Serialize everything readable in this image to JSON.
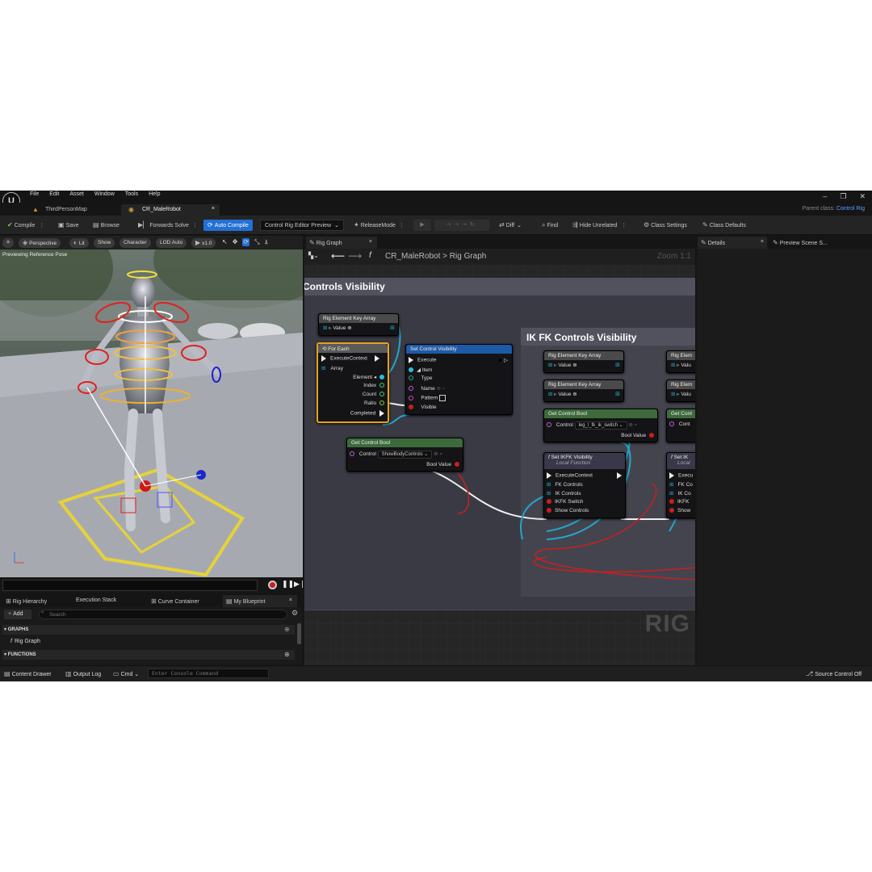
{
  "menu": [
    "File",
    "Edit",
    "Asset",
    "Window",
    "Tools",
    "Help"
  ],
  "window": {
    "parent_label": "Parent class:",
    "parent_value": "Control Rig",
    "min": "–",
    "restore": "❐",
    "close": "✕"
  },
  "tabs": [
    {
      "label": "ThirdPersonMap"
    },
    {
      "label": "CR_MaleRobot",
      "close": "×"
    }
  ],
  "toolbar": {
    "compile": "Compile",
    "save": "Save",
    "browse": "Browse",
    "forwards": "Forwards Solve",
    "auto_compile": "Auto Compile",
    "preview": "Control Rig Editor Preview",
    "release": "ReleaseMode",
    "diff": "Diff",
    "find": "Find",
    "hide": "Hide Unrelated",
    "class_settings": "Class Settings",
    "class_defaults": "Class Defaults"
  },
  "viewport": {
    "perspective": "Perspective",
    "lit": "Lit",
    "show": "Show",
    "character": "Character",
    "lod": "LOD Auto",
    "speed": "x1.0",
    "previewing": "Previewing Reference Pose"
  },
  "left_tabs": [
    "Rig Hierarchy",
    "Execution Stack",
    "Curve Container",
    "My Blueprint"
  ],
  "my_blueprint": {
    "add": "Add",
    "search_placeholder": "Search",
    "graphs": "GRAPHS",
    "rig_graph": "Rig Graph",
    "functions": "FUNCTIONS"
  },
  "graph_tab": {
    "label": "Rig Graph",
    "close": "×"
  },
  "breadcrumb": {
    "asset": "CR_MaleRobot",
    "sep": ">",
    "graph": "Rig Graph",
    "zoom": "Zoom 1:1"
  },
  "comments": {
    "left": "Controls Visibility",
    "right": "IK FK Controls Visibility"
  },
  "nodes": {
    "rig_key_array": {
      "title": "Rig Element Key Array",
      "pin": "Value"
    },
    "for_each": {
      "title": "For Each",
      "pins_in": [
        "ExecuteContext",
        "Array"
      ],
      "pins_out": [
        "Element",
        "Index",
        "Count",
        "Ratio",
        "Completed"
      ]
    },
    "set_vis": {
      "title": "Set Control Visibility",
      "pins": [
        "Execute",
        "Item",
        "Type",
        "Name",
        "Pattern",
        "Visible"
      ]
    },
    "get_bool_1": {
      "title": "Get Control Bool",
      "control_label": "Control",
      "control_value": "ShowBodyControls",
      "out": "Bool Value"
    },
    "rig_key_array_2": {
      "title": "Rig Element Key Array",
      "pin": "Value"
    },
    "rig_key_array_3": {
      "title": "Rig Element Key Array",
      "pin": "Value"
    },
    "get_bool_2": {
      "title": "Get Control Bool",
      "control_label": "Control",
      "control_value": "leg_l_fk_ik_switch",
      "out": "Bool Value"
    },
    "set_ikfk": {
      "title": "Set IKFK Visibility",
      "subtitle": "Local Function",
      "pins": [
        "ExecuteContext",
        "FK Controls",
        "IK Controls",
        "IKFK Switch",
        "Show Controls"
      ]
    },
    "clip_1": "Rig Elem",
    "clip_2": "Rig Elem",
    "clip_3": "Get Cont",
    "clip_4": "Set IK",
    "clip_4b": "Local",
    "clip_val": "Valu",
    "clip_ctrl": "Cont",
    "clip_pins": [
      "Execu",
      "FK Co",
      "IK Co",
      "IKFK",
      "Show"
    ]
  },
  "watermark": "RIG",
  "right_tabs": {
    "details": "Details",
    "close": "×",
    "preview": "Preview Scene S..."
  },
  "status": {
    "content_drawer": "Content Drawer",
    "output_log": "Output Log",
    "cmd": "Cmd",
    "console_placeholder": "Enter Console Command",
    "source_control": "Source Control Off"
  }
}
